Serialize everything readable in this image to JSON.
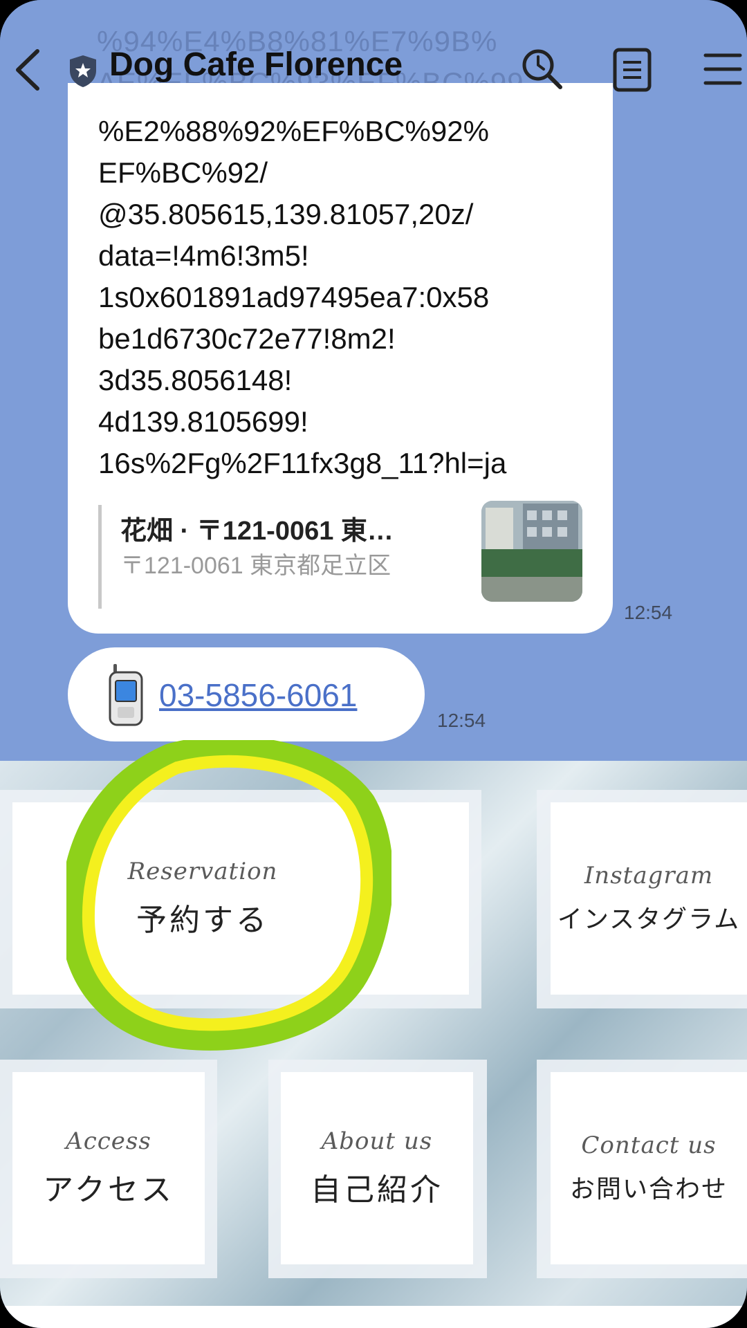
{
  "header": {
    "title": "Dog Cafe Florence"
  },
  "ghost_text": [
    "%94%E4%B8%81%E7%9B%",
    "AE%EF%BC%93%EF%BC%99"
  ],
  "message": {
    "lines": [
      "%E2%88%92%EF%BC%92%",
      "EF%BC%92/",
      "@35.805615,139.81057,20z/",
      "data=!4m6!3m5!",
      "1s0x601891ad97495ea7:0x58",
      "be1d6730c72e77!8m2!",
      "3d35.8056148!",
      "4d139.8105699!",
      "16s%2Fg%2F11fx3g8_11?hl=ja"
    ],
    "preview_title": "花畑 · 〒121-0061 東…",
    "preview_address": "〒121-0061 東京都足立区",
    "time": "12:54"
  },
  "phone_message": {
    "number": "03-5856-6061",
    "time": "12:54"
  },
  "rich_menu": {
    "reservation": {
      "en": "Reservation",
      "jp": "予約する"
    },
    "instagram": {
      "en": "Instagram",
      "jp": "インスタグラム"
    },
    "access": {
      "en": "Access",
      "jp": "アクセス"
    },
    "about": {
      "en": "About us",
      "jp": "自己紹介"
    },
    "contact": {
      "en": "Contact us",
      "jp": "お問い合わせ"
    }
  },
  "colors": {
    "chat_background": "#7e9dd8",
    "link": "#4a70c8",
    "highlight_outer": "#8ed11a",
    "highlight_inner": "#f4f01e"
  },
  "icons": [
    "back-icon",
    "shield-icon",
    "search-icon",
    "notes-icon",
    "menu-icon",
    "mobile-phone-icon"
  ]
}
